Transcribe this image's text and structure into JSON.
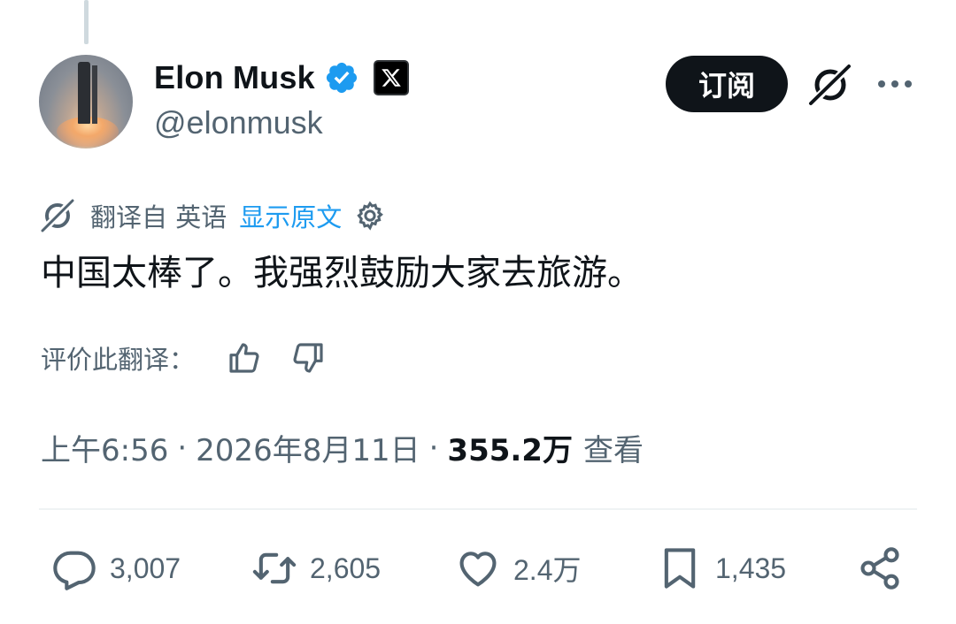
{
  "author": {
    "name": "Elon Musk",
    "handle": "@elonmusk",
    "verified_color": "#1d9bf0"
  },
  "header": {
    "subscribe_label": "订阅",
    "grok_icon": "grok-slash-icon",
    "more_icon": "more-dots-icon"
  },
  "translation": {
    "translated_from": "翻译自 英语",
    "show_original": "显示原文",
    "rate_label": "评价此翻译："
  },
  "tweet": {
    "text": "中国太棒了。我强烈鼓励大家去旅游。"
  },
  "meta": {
    "time": "上午6:56",
    "date": "2026年8月11日",
    "views": "355.2万",
    "views_label": "查看"
  },
  "actions": {
    "replies": "3,007",
    "reposts": "2,605",
    "likes": "2.4万",
    "bookmarks": "1,435"
  },
  "colors": {
    "text_primary": "#0f1419",
    "text_secondary": "#536471",
    "link": "#1d9bf0",
    "divider": "#eff3f4"
  }
}
